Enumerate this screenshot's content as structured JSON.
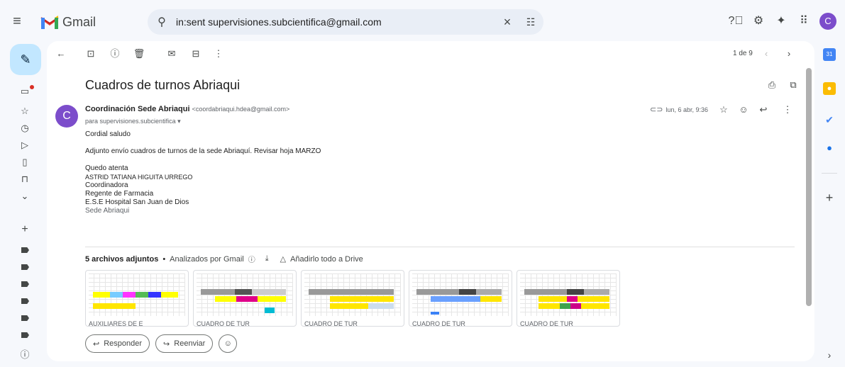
{
  "app": {
    "name": "Gmail"
  },
  "search": {
    "query": "in:sent supervisiones.subcientifica@gmail.com"
  },
  "account": {
    "initial": "C"
  },
  "email": {
    "subject": "Cuadros de turnos Abriaqui",
    "sender_name": "Coordinación Sede Abriaqui",
    "sender_email": "<coordabriaqui.hdea@gmail.com>",
    "to_line": "para supervisiones.subcientifica",
    "date": "lun, 6 abr, 9:36",
    "body": [
      "Cordial saludo",
      "",
      "Adjunto envío cuadros de turnos de la sede Abriaquí. Revisar hoja MARZO",
      "",
      "Quedo atenta",
      "ASTRID TATIANA HIGUITA URREGO",
      "Coordinadora",
      "Regente de Farmacia",
      "E.S.E Hospital San Juan de Dios",
      "Sede Abriaqui"
    ]
  },
  "pager": {
    "text": "1 de 9"
  },
  "attachments": {
    "count_label": "5 archivos adjuntos",
    "separator": "•",
    "analyzed_label": "Analizados por Gmail",
    "drive_label": "Añadirlo todo a Drive",
    "files": [
      {
        "name": "AUXILIARES DE E"
      },
      {
        "name": "CUADRO DE TUR"
      },
      {
        "name": "CUADRO DE TUR"
      },
      {
        "name": "CUADRO DE TUR"
      },
      {
        "name": "CUADRO DE TUR"
      }
    ]
  },
  "actions": {
    "reply": "Responder",
    "forward": "Reenviar"
  },
  "colors": {
    "accent": "#c2e7ff",
    "avatar": "#7c4dcb",
    "unread_dot": "#d93025"
  }
}
